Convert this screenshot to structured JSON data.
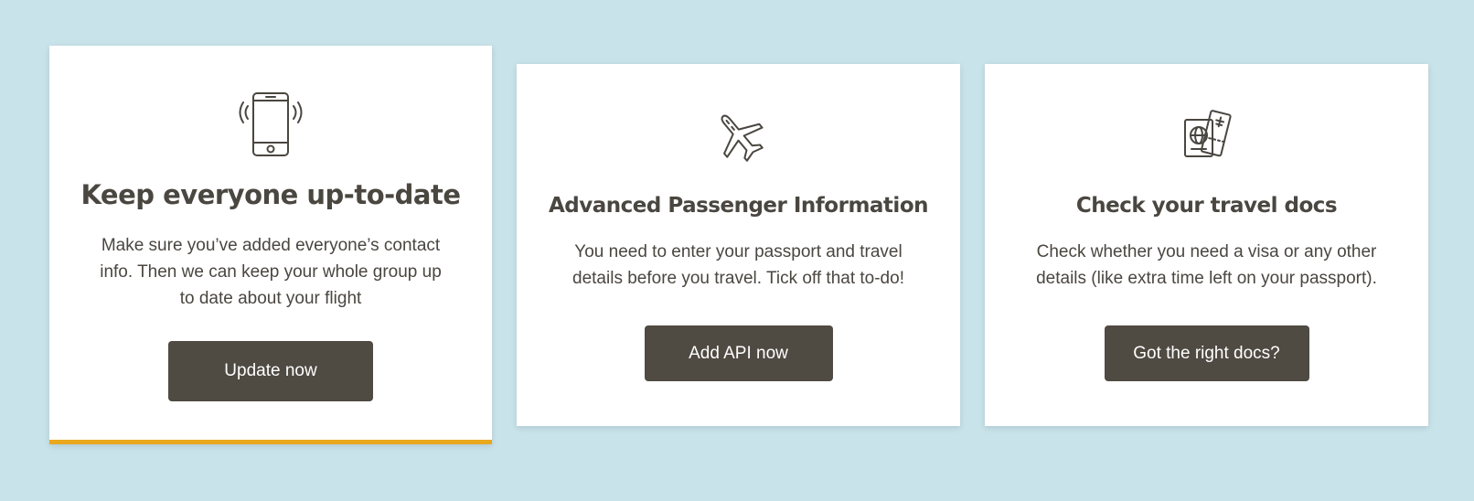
{
  "cards": [
    {
      "icon": "mobile-phone-vibrating-icon",
      "title": "Keep everyone up-to-date",
      "description": "Make sure you’ve added everyone’s contact info. Then we can keep your whole group up to date about your flight",
      "button_label": "Update now",
      "active": true
    },
    {
      "icon": "airplane-icon",
      "title": "Advanced Passenger Information",
      "description": "You need to enter your passport and travel details before you travel. Tick off that to-do!",
      "button_label": "Add API now",
      "active": false
    },
    {
      "icon": "passport-ticket-icon",
      "title": "Check your travel docs",
      "description": "Check whether you need a visa or any other details (like extra time left on your passport).",
      "button_label": "Got the right docs?",
      "active": false
    }
  ],
  "colors": {
    "background": "#c9e3ea",
    "card": "#ffffff",
    "text": "#4a4640",
    "button": "#4f4a42",
    "active_accent": "#e9a81d"
  }
}
